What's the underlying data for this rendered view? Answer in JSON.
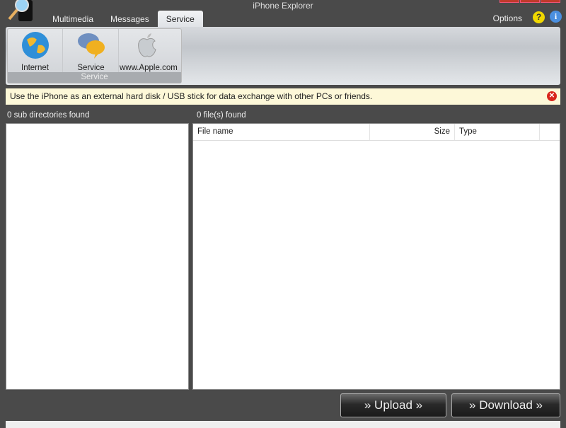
{
  "window": {
    "title": "iPhone Explorer"
  },
  "tabs": [
    {
      "label": "Multimedia"
    },
    {
      "label": "Messages"
    },
    {
      "label": "Service",
      "active": true
    }
  ],
  "header": {
    "options_label": "Options",
    "help_icon": "help-icon",
    "info_icon": "info-icon"
  },
  "ribbon": {
    "group_label": "Service",
    "buttons": [
      {
        "label": "Internet",
        "icon": "globe-icon"
      },
      {
        "label": "Service",
        "icon": "chat-bubbles-icon"
      },
      {
        "label": "www.Apple.com",
        "icon": "apple-icon"
      }
    ]
  },
  "notice": {
    "text": "Use the iPhone as an external hard disk / USB stick for data exchange with other PCs or friends."
  },
  "left_pane": {
    "count_label": "0 sub directories found"
  },
  "right_pane": {
    "count_label": "0 file(s) found",
    "columns": [
      "File name",
      "Size",
      "Type"
    ]
  },
  "actions": {
    "upload": "» Upload »",
    "download": "» Download »"
  }
}
